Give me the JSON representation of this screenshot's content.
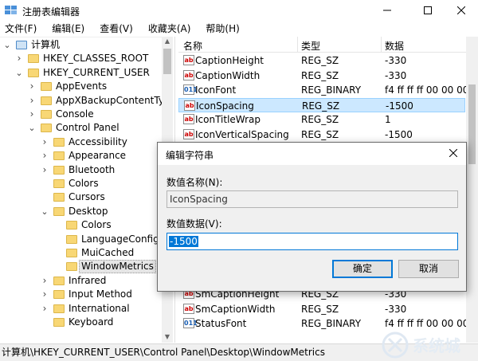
{
  "window": {
    "title": "注册表编辑器",
    "min_icon": "minimize-icon",
    "max_icon": "maximize-icon",
    "close_icon": "close-icon"
  },
  "menu": [
    "文件(F)",
    "编辑(E)",
    "查看(V)",
    "收藏夹(A)",
    "帮助(H)"
  ],
  "tree": {
    "items": [
      {
        "label": "计算机",
        "level": 0,
        "expanded": true,
        "icon": "computer-icon"
      },
      {
        "label": "HKEY_CLASSES_ROOT",
        "level": 1,
        "expanded": false
      },
      {
        "label": "HKEY_CURRENT_USER",
        "level": 1,
        "expanded": true
      },
      {
        "label": "AppEvents",
        "level": 2,
        "expanded": false
      },
      {
        "label": "AppXBackupContentType",
        "level": 2,
        "expanded": false
      },
      {
        "label": "Console",
        "level": 2,
        "expanded": false
      },
      {
        "label": "Control Panel",
        "level": 2,
        "expanded": true
      },
      {
        "label": "Accessibility",
        "level": 3,
        "expanded": false
      },
      {
        "label": "Appearance",
        "level": 3,
        "expanded": false
      },
      {
        "label": "Bluetooth",
        "level": 3,
        "expanded": false
      },
      {
        "label": "Colors",
        "level": 3,
        "expanded": null
      },
      {
        "label": "Cursors",
        "level": 3,
        "expanded": null
      },
      {
        "label": "Desktop",
        "level": 3,
        "expanded": true
      },
      {
        "label": "Colors",
        "level": 4,
        "expanded": null
      },
      {
        "label": "LanguageConfigu",
        "level": 4,
        "expanded": null
      },
      {
        "label": "MuiCached",
        "level": 4,
        "expanded": null
      },
      {
        "label": "WindowMetrics",
        "level": 4,
        "expanded": null,
        "selected": true
      },
      {
        "label": "Infrared",
        "level": 3,
        "expanded": false
      },
      {
        "label": "Input Method",
        "level": 3,
        "expanded": false
      },
      {
        "label": "International",
        "level": 3,
        "expanded": false
      },
      {
        "label": "Keyboard",
        "level": 3,
        "expanded": null
      }
    ]
  },
  "list": {
    "headers": {
      "name": "名称",
      "type": "类型",
      "data": "数据"
    },
    "rows": [
      {
        "name": "CaptionHeight",
        "type": "REG_SZ",
        "data": "-330",
        "kind": "sz"
      },
      {
        "name": "CaptionWidth",
        "type": "REG_SZ",
        "data": "-330",
        "kind": "sz"
      },
      {
        "name": "IconFont",
        "type": "REG_BINARY",
        "data": "f4 ff ff ff 00 00 00 00",
        "kind": "bin"
      },
      {
        "name": "IconSpacing",
        "type": "REG_SZ",
        "data": "-1500",
        "kind": "sz",
        "selected": true
      },
      {
        "name": "IconTitleWrap",
        "type": "REG_SZ",
        "data": "1",
        "kind": "sz"
      },
      {
        "name": "IconVerticalSpacing",
        "type": "REG_SZ",
        "data": "-1500",
        "kind": "sz"
      }
    ],
    "rows_bottom": [
      {
        "name": "SmCaptionHeight",
        "type": "REG_SZ",
        "data": "-330",
        "kind": "sz"
      },
      {
        "name": "SmCaptionWidth",
        "type": "REG_SZ",
        "data": "-330",
        "kind": "sz"
      },
      {
        "name": "StatusFont",
        "type": "REG_BINARY",
        "data": "f4 ff ff ff 00 00 00 00",
        "kind": "bin"
      }
    ],
    "value_icon_sz": "ab",
    "value_icon_bin": "011"
  },
  "dialog": {
    "title": "编辑字符串",
    "name_label": "数值名称(N):",
    "name_value": "IconSpacing",
    "data_label": "数值数据(V):",
    "data_value": "-1500",
    "ok": "确定",
    "cancel": "取消"
  },
  "status": "计算机\\HKEY_CURRENT_USER\\Control Panel\\Desktop\\WindowMetrics",
  "watermark": "系统城",
  "colors": {
    "selection": "#cce8ff",
    "accent": "#0078d7",
    "folder": "#f8d775"
  }
}
